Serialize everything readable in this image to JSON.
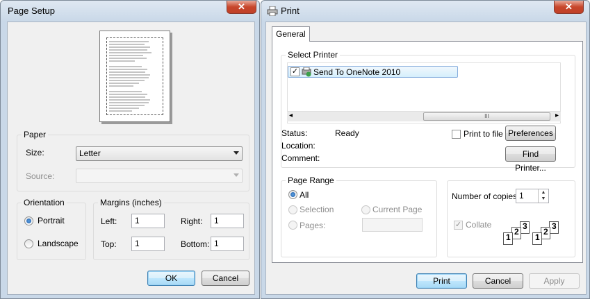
{
  "page_setup": {
    "title": "Page Setup",
    "close_glyph": "✕",
    "paper": {
      "legend": "Paper",
      "size_label": "Size:",
      "size_value": "Letter",
      "source_label": "Source:",
      "source_value": ""
    },
    "orientation": {
      "legend": "Orientation",
      "portrait": "Portrait",
      "landscape": "Landscape",
      "selected": "portrait"
    },
    "margins": {
      "legend": "Margins (inches)",
      "left_label": "Left:",
      "left_value": "1",
      "right_label": "Right:",
      "right_value": "1",
      "top_label": "Top:",
      "top_value": "1",
      "bottom_label": "Bottom:",
      "bottom_value": "1"
    },
    "ok_label": "OK",
    "cancel_label": "Cancel"
  },
  "print": {
    "title": "Print",
    "close_glyph": "✕",
    "tab_general": "General",
    "select_printer": {
      "legend": "Select Printer",
      "printer_name": "Send To OneNote 2010",
      "scroll_left": "◂",
      "scroll_right": "▸",
      "thumb_grip": "III"
    },
    "status_label": "Status:",
    "status_value": "Ready",
    "location_label": "Location:",
    "location_value": "",
    "comment_label": "Comment:",
    "comment_value": "",
    "print_to_file": "Print to file",
    "preferences_label": "Preferences",
    "find_printer_label": "Find Printer...",
    "page_range": {
      "legend": "Page Range",
      "all": "All",
      "selection": "Selection",
      "current_page": "Current Page",
      "pages": "Pages:",
      "pages_value": ""
    },
    "copies": {
      "label": "Number of copies:",
      "value": "1",
      "collate": "Collate",
      "collate_checked": true
    },
    "print_label": "Print",
    "cancel_label": "Cancel",
    "apply_label": "Apply"
  },
  "colors": {
    "accent": "#3c7fb1",
    "close_red": "#c7462b",
    "window_frame": "#c9d8e8",
    "client_bg": "#f0f0f0"
  }
}
